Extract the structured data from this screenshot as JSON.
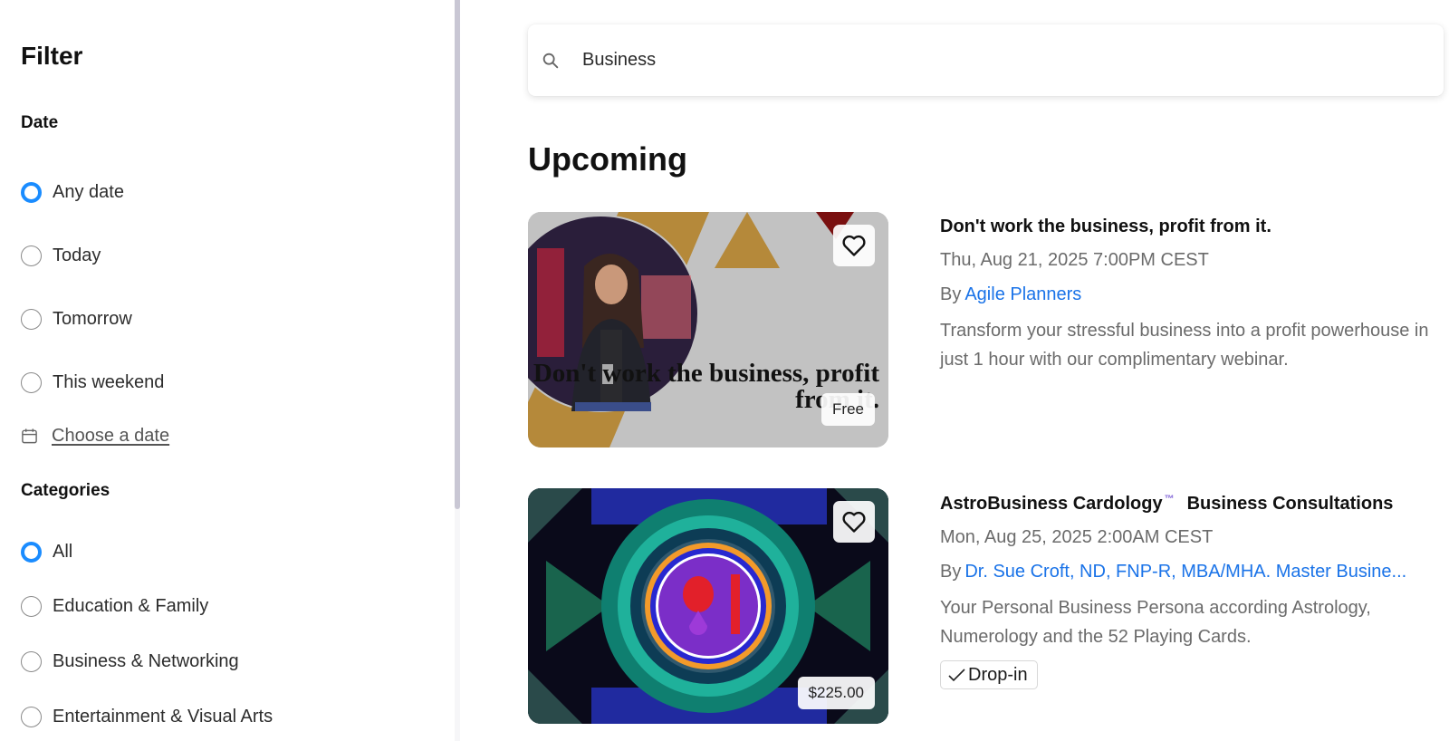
{
  "sidebar": {
    "title": "Filter",
    "date_section": {
      "title": "Date",
      "options": [
        "Any date",
        "Today",
        "Tomorrow",
        "This weekend"
      ],
      "selected": "Any date",
      "choose_date_label": "Choose a date"
    },
    "categories_section": {
      "title": "Categories",
      "options": [
        "All",
        "Education & Family",
        "Business & Networking",
        "Entertainment & Visual Arts"
      ],
      "selected": "All"
    }
  },
  "search": {
    "value": "Business",
    "icon": "search-icon"
  },
  "main": {
    "heading": "Upcoming",
    "events": [
      {
        "title": "Don't work the business, profit from it.",
        "date": "Thu, Aug 21, 2025 7:00PM CEST",
        "by_label": "By",
        "organizer": "Agile Planners",
        "description": "Transform your stressful business into a profit powerhouse in just 1 hour with our complimentary webinar.",
        "price": "Free",
        "image_text": "Don't work the business, profit from it."
      },
      {
        "title_part1": "AstroBusiness Cardology",
        "title_tm": "™",
        "title_part2": "Business Consultations",
        "date": "Mon, Aug 25, 2025 2:00AM CEST",
        "by_label": "By",
        "organizer": "Dr. Sue Croft, ND, FNP-R, MBA/MHA. Master Busine...",
        "description": "Your Personal Business Persona according Astrology, Numerology and the 52 Playing Cards.",
        "price": "$225.00",
        "tag": "Drop-in"
      }
    ]
  },
  "colors": {
    "accent": "#1a8cff",
    "link": "#1a73e8",
    "gold": "#b5893a"
  }
}
